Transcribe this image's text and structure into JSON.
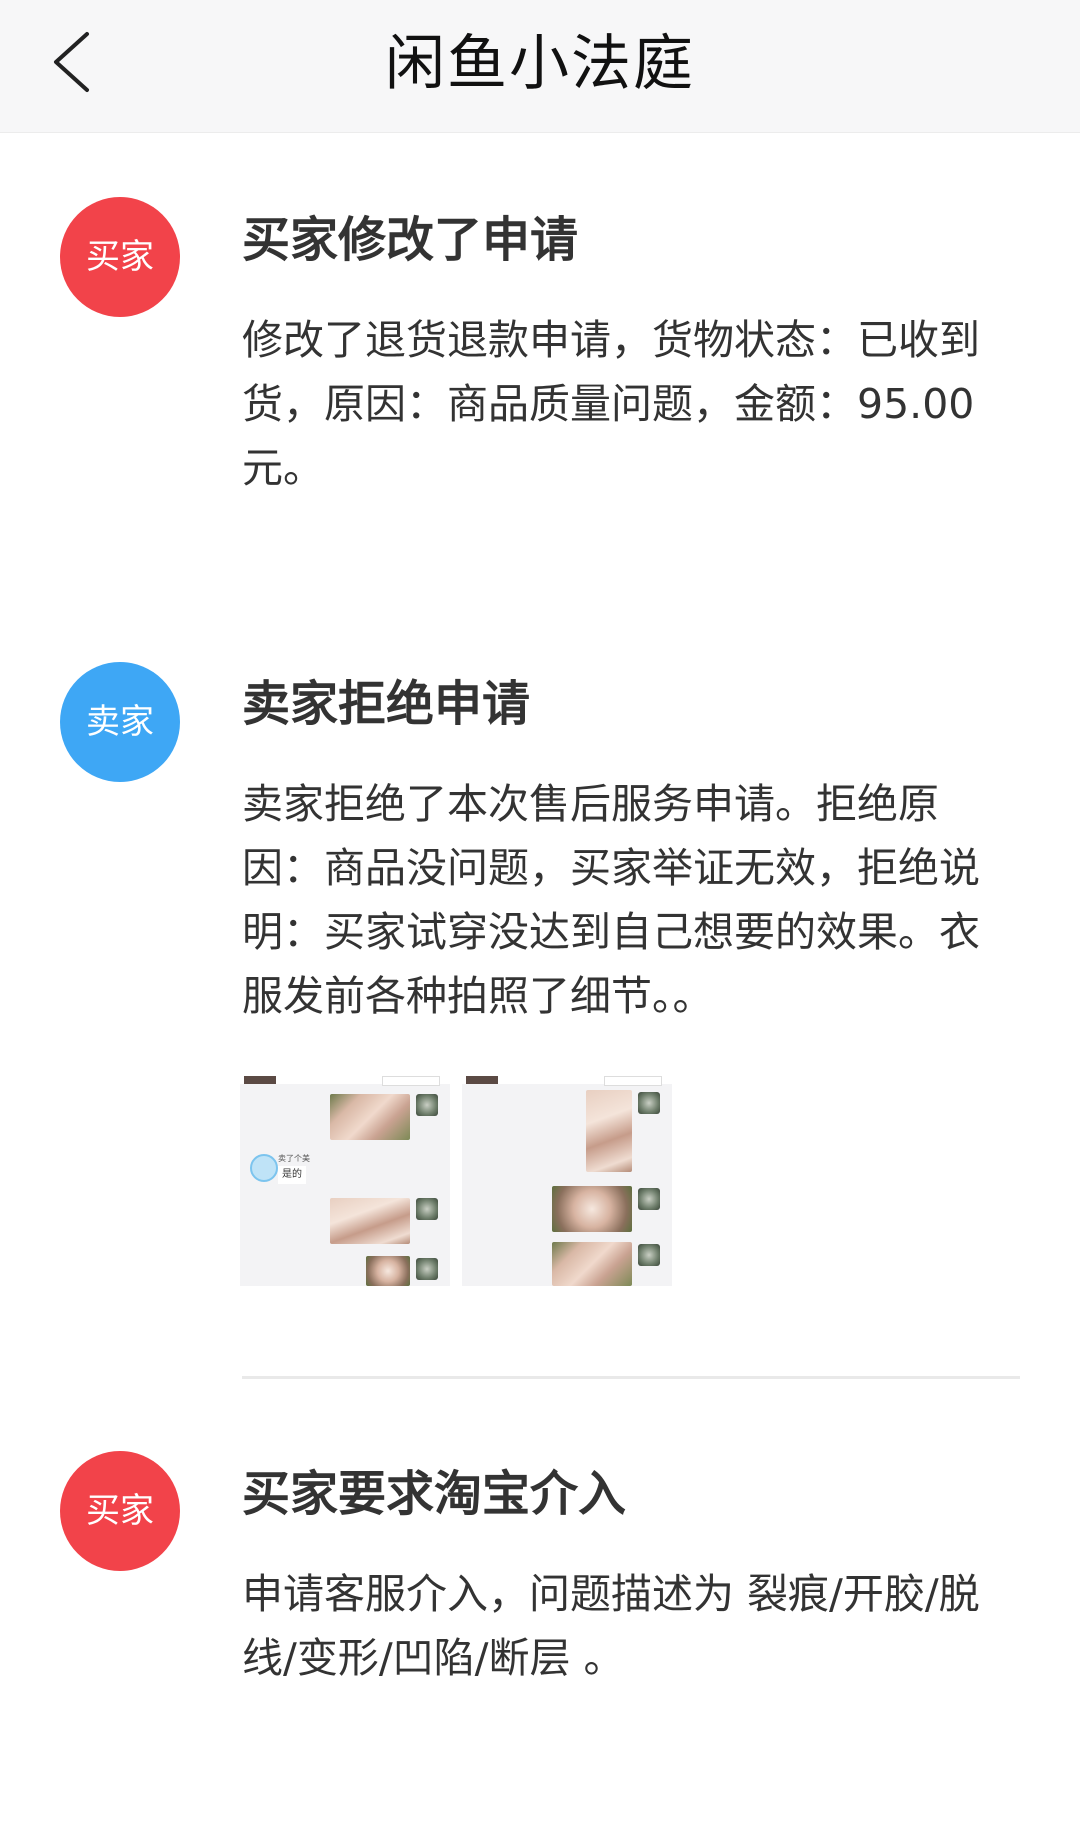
{
  "header": {
    "title": "闲鱼小法庭"
  },
  "entries": [
    {
      "role": "买家",
      "title": "买家修改了申请",
      "description": "修改了退货退款申请，货物状态：已收到货，原因：商品质量问题，金额：95.00元。"
    },
    {
      "role": "卖家",
      "title": "卖家拒绝申请",
      "description": "卖家拒绝了本次售后服务申请。拒绝原因：商品没问题，买家举证无效，拒绝说明：买家试穿没达到自己想要的效果。衣服发前各种拍照了细节。。",
      "attachments": [
        {
          "chat_name": "卖了个美",
          "chat_text": "是的"
        },
        {}
      ]
    },
    {
      "role": "买家",
      "title": "买家要求淘宝介入",
      "description": "申请客服介入，问题描述为 裂痕/开胶/脱线/变形/凹陷/断层 。"
    }
  ],
  "colors": {
    "buyer_avatar": "#f2434a",
    "seller_avatar": "#3ea7f5",
    "header_bg": "#f7f7f8"
  },
  "icons": {
    "back": "chevron-left-icon"
  }
}
